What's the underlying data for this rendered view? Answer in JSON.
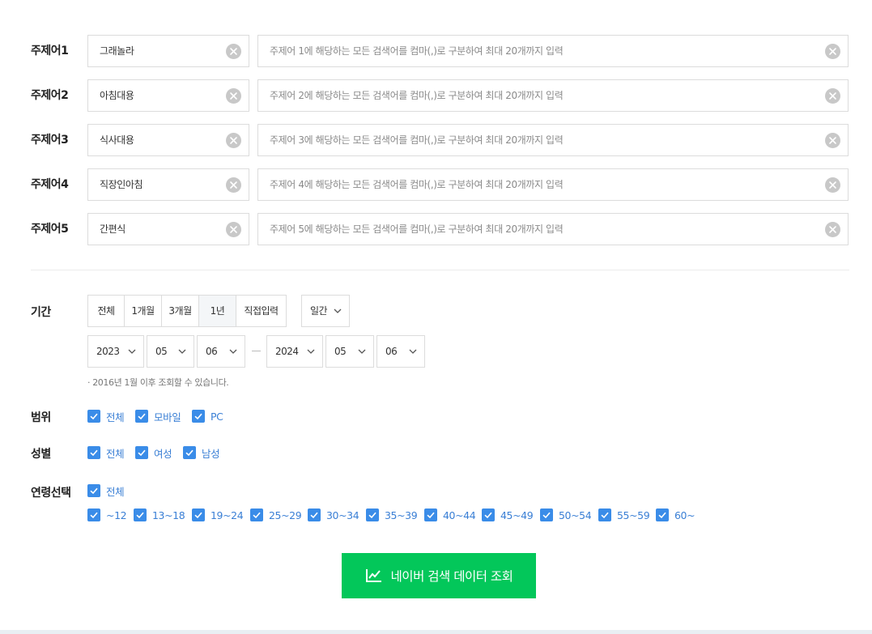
{
  "topics": [
    {
      "label": "주제어1",
      "value": "그래놀라",
      "placeholder": "주제어 1에 해당하는 모든 검색어를 컴마(,)로 구분하여 최대 20개까지 입력"
    },
    {
      "label": "주제어2",
      "value": "아침대용",
      "placeholder": "주제어 2에 해당하는 모든 검색어를 컴마(,)로 구분하여 최대 20개까지 입력"
    },
    {
      "label": "주제어3",
      "value": "식사대용",
      "placeholder": "주제어 3에 해당하는 모든 검색어를 컴마(,)로 구분하여 최대 20개까지 입력"
    },
    {
      "label": "주제어4",
      "value": "직장인아침",
      "placeholder": "주제어 4에 해당하는 모든 검색어를 컴마(,)로 구분하여 최대 20개까지 입력"
    },
    {
      "label": "주제어5",
      "value": "간편식",
      "placeholder": "주제어 5에 해당하는 모든 검색어를 컴마(,)로 구분하여 최대 20개까지 입력"
    }
  ],
  "period": {
    "label": "기간",
    "buttons": [
      "전체",
      "1개월",
      "3개월",
      "1년",
      "직접입력"
    ],
    "active": "1년",
    "interval": "일간",
    "start": {
      "year": "2023",
      "month": "05",
      "day": "06"
    },
    "end": {
      "year": "2024",
      "month": "05",
      "day": "06"
    },
    "note": "· 2016년 1월 이후 조회할 수 있습니다."
  },
  "scope": {
    "label": "범위",
    "options": [
      "전체",
      "모바일",
      "PC"
    ]
  },
  "gender": {
    "label": "성별",
    "options": [
      "전체",
      "여성",
      "남성"
    ]
  },
  "age": {
    "label": "연령선택",
    "all": "전체",
    "options": [
      "~12",
      "13~18",
      "19~24",
      "25~29",
      "30~34",
      "35~39",
      "40~44",
      "45~49",
      "50~54",
      "55~59",
      "60~"
    ]
  },
  "search_button": {
    "label": "네이버 검색 데이터 조회",
    "icon": "line-chart-icon"
  },
  "colors": {
    "accent": "#03c75a",
    "checkbox": "#3a8ce8",
    "check_label": "#3a7fd5"
  }
}
